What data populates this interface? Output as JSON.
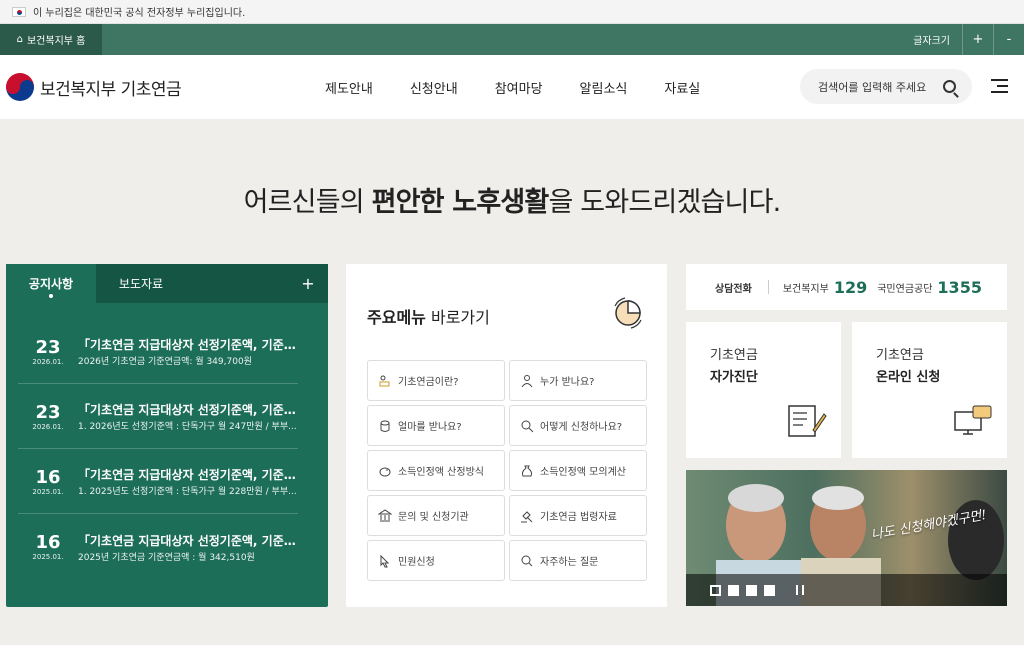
{
  "gov_strip": {
    "text": "이 누리집은 대한민국 공식 전자정부 누리집입니다."
  },
  "util": {
    "home": "보건복지부 홈",
    "font_size_label": "글자크기",
    "plus": "+",
    "minus": "-"
  },
  "header": {
    "logo": "보건복지부 기초연금",
    "search_placeholder": "검색어를 입력해 주세요"
  },
  "nav": [
    "제도안내",
    "신청안내",
    "참여마당",
    "알림소식",
    "자료실"
  ],
  "hero": {
    "pre": "어르신들의 ",
    "bold": "편안한 노후생활",
    "post": "을 도와드리겠습니다."
  },
  "notice": {
    "tabs": [
      "공지사항",
      "보도자료"
    ],
    "more": "+",
    "items": [
      {
        "day": "23",
        "ym": "2026.01.",
        "title": "「기초연금 지급대상자 선정기준액, 기준연금...",
        "sub": "2026년 기초연금 기준연금액: 월 349,700원"
      },
      {
        "day": "23",
        "ym": "2026.01.",
        "title": "「기초연금 지급대상자 선정기준액, 기준연금...",
        "sub": "1. 2026년도 선정기준액 : 단독가구 월 247만원 / 부부..."
      },
      {
        "day": "16",
        "ym": "2025.01.",
        "title": "「기초연금 지급대상자 선정기준액, 기준연금...",
        "sub": "1. 2025년도 선정기준액 : 단독가구 월 228만원 / 부부..."
      },
      {
        "day": "16",
        "ym": "2025.01.",
        "title": "「기초연금 지급대상자 선정기준액, 기준연금...",
        "sub": "2025년 기초연금 기준연금액 : 월 342,510원"
      }
    ]
  },
  "quick": {
    "title_bold": "주요메뉴",
    "title_rest": " 바로가기",
    "items": [
      "기초연금이란?",
      "누가 받나요?",
      "얼마를 받나요?",
      "어떻게 신청하나요?",
      "소득인정액 산정방식",
      "소득인정액 모의계산",
      "문의 및 신청기관",
      "기초연금 법령자료",
      "민원신청",
      "자주하는 질문"
    ]
  },
  "call": {
    "label": "상담전화",
    "org1": "보건복지부",
    "num1": "129",
    "org2": "국민연금공단",
    "num2": "1355"
  },
  "cards": [
    {
      "line1": "기초연금",
      "line2": "자가진단"
    },
    {
      "line1": "기초연금",
      "line2": "온라인 신청"
    }
  ],
  "banner": {
    "slogan": "나도 신청해야겠구먼!"
  },
  "colors": {
    "primary_green": "#1d6e58",
    "util_green": "#3f7563"
  }
}
